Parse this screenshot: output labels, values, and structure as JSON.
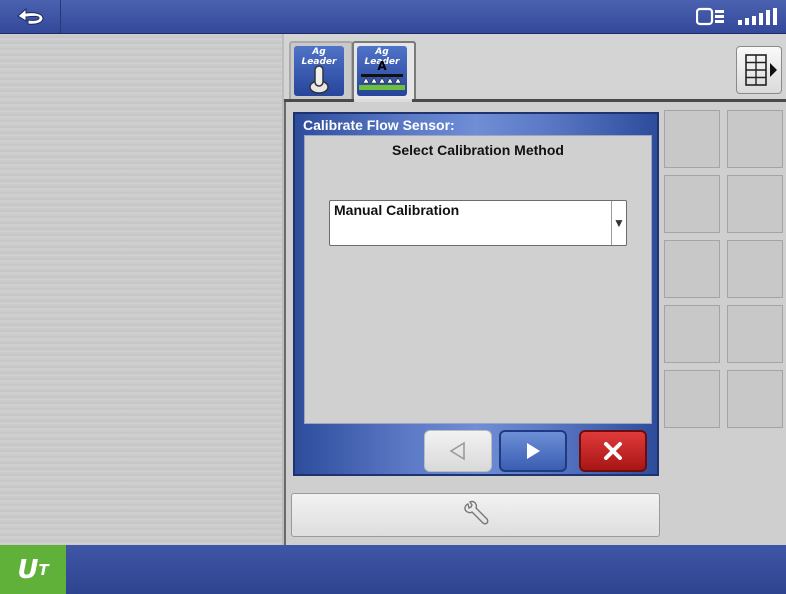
{
  "topbar": {
    "back_icon": "back-arrow-icon",
    "status_icons": [
      "display-connection-icon",
      "gps-signal-icon"
    ]
  },
  "tabs": [
    {
      "brand": "Ag Leader",
      "icon": "joystick-icon"
    },
    {
      "brand": "Ag Leader",
      "icon": "sprayer-icon",
      "badge": "A"
    }
  ],
  "layout_button": {
    "icon": "grid-layout-icon"
  },
  "dialog": {
    "title": "Calibrate Flow Sensor:",
    "subtitle": "Select Calibration Method",
    "dropdown": {
      "value": "Manual Calibration",
      "arrow": "▼"
    },
    "buttons": {
      "prev": "previous-icon",
      "next": "next-icon",
      "cancel": "cancel-icon"
    }
  },
  "tool_button": {
    "icon": "wrench-icon"
  },
  "bottombar": {
    "logo": "U",
    "logo_sub": "T"
  },
  "colors": {
    "bar_blue": "#3a4f9e",
    "logo_green": "#5fb13a",
    "cancel_red": "#c42020",
    "next_blue": "#4a6fc4"
  }
}
